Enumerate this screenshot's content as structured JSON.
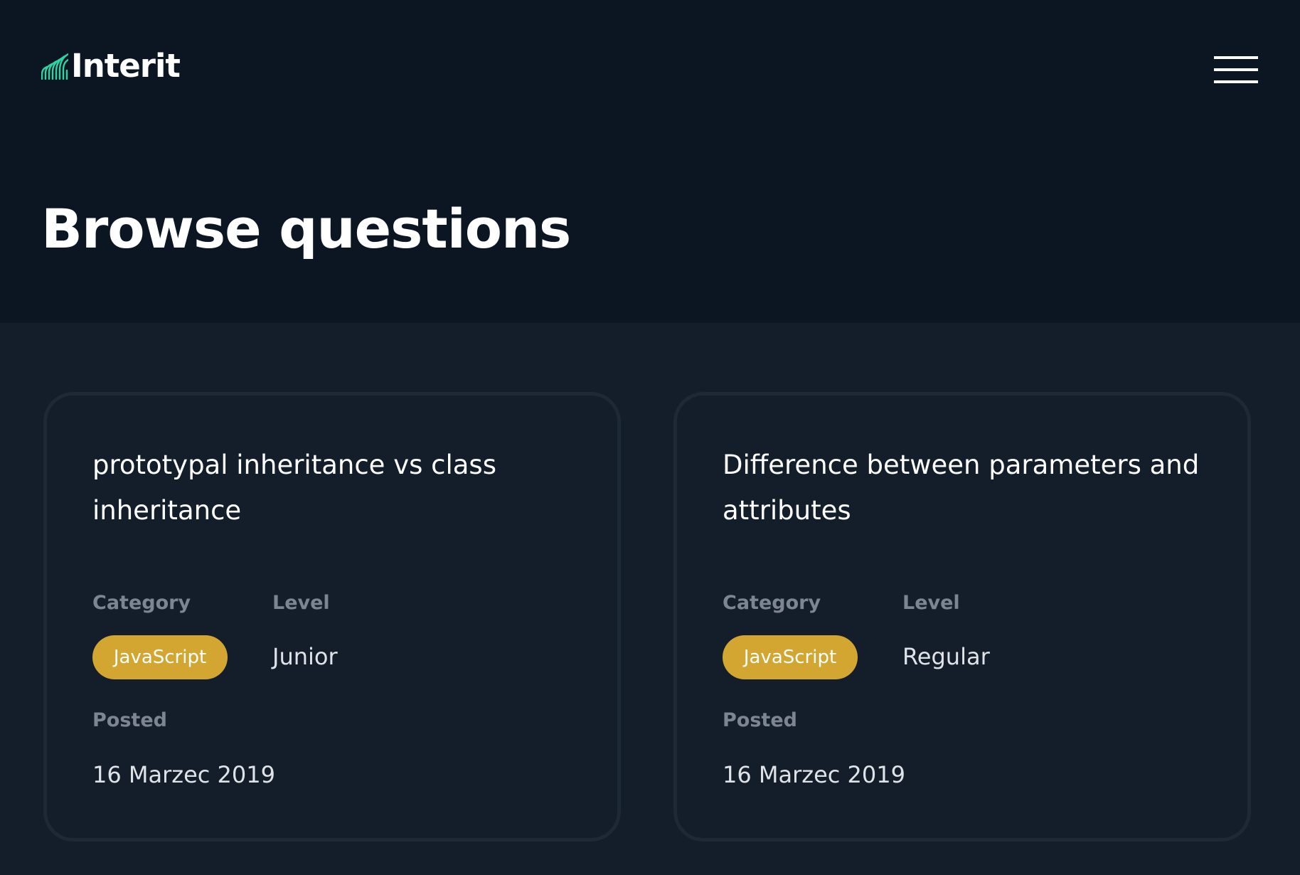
{
  "brand": {
    "name": "Interit",
    "logo_icon": "curved-lines-logo-icon",
    "accent_color": "#2dd4a4"
  },
  "header": {
    "menu_icon": "hamburger-menu-icon"
  },
  "page": {
    "title": "Browse questions"
  },
  "questions": [
    {
      "title": "prototypal inheritance vs class inheritance",
      "category_label": "Category",
      "category": "JavaScript",
      "level_label": "Level",
      "level": "Junior",
      "posted_label": "Posted",
      "posted": "16 Marzec 2019"
    },
    {
      "title": "Difference between parameters and attributes",
      "category_label": "Category",
      "category": "JavaScript",
      "level_label": "Level",
      "level": "Regular",
      "posted_label": "Posted",
      "posted": "16 Marzec 2019"
    }
  ],
  "colors": {
    "header_background": "#0b1622",
    "content_background": "#131e2a",
    "category_badge": "#d2a631",
    "label_text": "#7d8690"
  }
}
